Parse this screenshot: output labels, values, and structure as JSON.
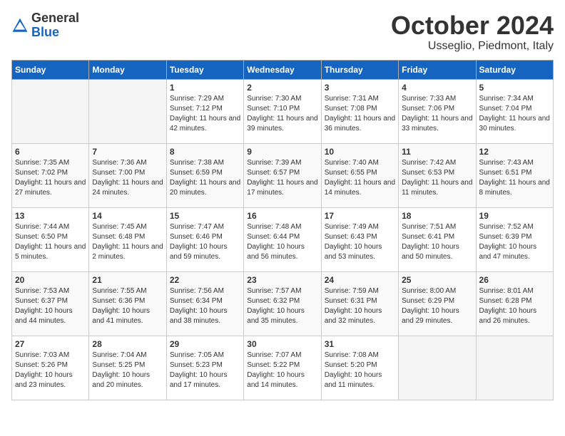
{
  "header": {
    "logo_general": "General",
    "logo_blue": "Blue",
    "month": "October 2024",
    "location": "Usseglio, Piedmont, Italy"
  },
  "weekdays": [
    "Sunday",
    "Monday",
    "Tuesday",
    "Wednesday",
    "Thursday",
    "Friday",
    "Saturday"
  ],
  "weeks": [
    [
      {
        "day": "",
        "info": ""
      },
      {
        "day": "",
        "info": ""
      },
      {
        "day": "1",
        "info": "Sunrise: 7:29 AM\nSunset: 7:12 PM\nDaylight: 11 hours and 42 minutes."
      },
      {
        "day": "2",
        "info": "Sunrise: 7:30 AM\nSunset: 7:10 PM\nDaylight: 11 hours and 39 minutes."
      },
      {
        "day": "3",
        "info": "Sunrise: 7:31 AM\nSunset: 7:08 PM\nDaylight: 11 hours and 36 minutes."
      },
      {
        "day": "4",
        "info": "Sunrise: 7:33 AM\nSunset: 7:06 PM\nDaylight: 11 hours and 33 minutes."
      },
      {
        "day": "5",
        "info": "Sunrise: 7:34 AM\nSunset: 7:04 PM\nDaylight: 11 hours and 30 minutes."
      }
    ],
    [
      {
        "day": "6",
        "info": "Sunrise: 7:35 AM\nSunset: 7:02 PM\nDaylight: 11 hours and 27 minutes."
      },
      {
        "day": "7",
        "info": "Sunrise: 7:36 AM\nSunset: 7:00 PM\nDaylight: 11 hours and 24 minutes."
      },
      {
        "day": "8",
        "info": "Sunrise: 7:38 AM\nSunset: 6:59 PM\nDaylight: 11 hours and 20 minutes."
      },
      {
        "day": "9",
        "info": "Sunrise: 7:39 AM\nSunset: 6:57 PM\nDaylight: 11 hours and 17 minutes."
      },
      {
        "day": "10",
        "info": "Sunrise: 7:40 AM\nSunset: 6:55 PM\nDaylight: 11 hours and 14 minutes."
      },
      {
        "day": "11",
        "info": "Sunrise: 7:42 AM\nSunset: 6:53 PM\nDaylight: 11 hours and 11 minutes."
      },
      {
        "day": "12",
        "info": "Sunrise: 7:43 AM\nSunset: 6:51 PM\nDaylight: 11 hours and 8 minutes."
      }
    ],
    [
      {
        "day": "13",
        "info": "Sunrise: 7:44 AM\nSunset: 6:50 PM\nDaylight: 11 hours and 5 minutes."
      },
      {
        "day": "14",
        "info": "Sunrise: 7:45 AM\nSunset: 6:48 PM\nDaylight: 11 hours and 2 minutes."
      },
      {
        "day": "15",
        "info": "Sunrise: 7:47 AM\nSunset: 6:46 PM\nDaylight: 10 hours and 59 minutes."
      },
      {
        "day": "16",
        "info": "Sunrise: 7:48 AM\nSunset: 6:44 PM\nDaylight: 10 hours and 56 minutes."
      },
      {
        "day": "17",
        "info": "Sunrise: 7:49 AM\nSunset: 6:43 PM\nDaylight: 10 hours and 53 minutes."
      },
      {
        "day": "18",
        "info": "Sunrise: 7:51 AM\nSunset: 6:41 PM\nDaylight: 10 hours and 50 minutes."
      },
      {
        "day": "19",
        "info": "Sunrise: 7:52 AM\nSunset: 6:39 PM\nDaylight: 10 hours and 47 minutes."
      }
    ],
    [
      {
        "day": "20",
        "info": "Sunrise: 7:53 AM\nSunset: 6:37 PM\nDaylight: 10 hours and 44 minutes."
      },
      {
        "day": "21",
        "info": "Sunrise: 7:55 AM\nSunset: 6:36 PM\nDaylight: 10 hours and 41 minutes."
      },
      {
        "day": "22",
        "info": "Sunrise: 7:56 AM\nSunset: 6:34 PM\nDaylight: 10 hours and 38 minutes."
      },
      {
        "day": "23",
        "info": "Sunrise: 7:57 AM\nSunset: 6:32 PM\nDaylight: 10 hours and 35 minutes."
      },
      {
        "day": "24",
        "info": "Sunrise: 7:59 AM\nSunset: 6:31 PM\nDaylight: 10 hours and 32 minutes."
      },
      {
        "day": "25",
        "info": "Sunrise: 8:00 AM\nSunset: 6:29 PM\nDaylight: 10 hours and 29 minutes."
      },
      {
        "day": "26",
        "info": "Sunrise: 8:01 AM\nSunset: 6:28 PM\nDaylight: 10 hours and 26 minutes."
      }
    ],
    [
      {
        "day": "27",
        "info": "Sunrise: 7:03 AM\nSunset: 5:26 PM\nDaylight: 10 hours and 23 minutes."
      },
      {
        "day": "28",
        "info": "Sunrise: 7:04 AM\nSunset: 5:25 PM\nDaylight: 10 hours and 20 minutes."
      },
      {
        "day": "29",
        "info": "Sunrise: 7:05 AM\nSunset: 5:23 PM\nDaylight: 10 hours and 17 minutes."
      },
      {
        "day": "30",
        "info": "Sunrise: 7:07 AM\nSunset: 5:22 PM\nDaylight: 10 hours and 14 minutes."
      },
      {
        "day": "31",
        "info": "Sunrise: 7:08 AM\nSunset: 5:20 PM\nDaylight: 10 hours and 11 minutes."
      },
      {
        "day": "",
        "info": ""
      },
      {
        "day": "",
        "info": ""
      }
    ]
  ]
}
